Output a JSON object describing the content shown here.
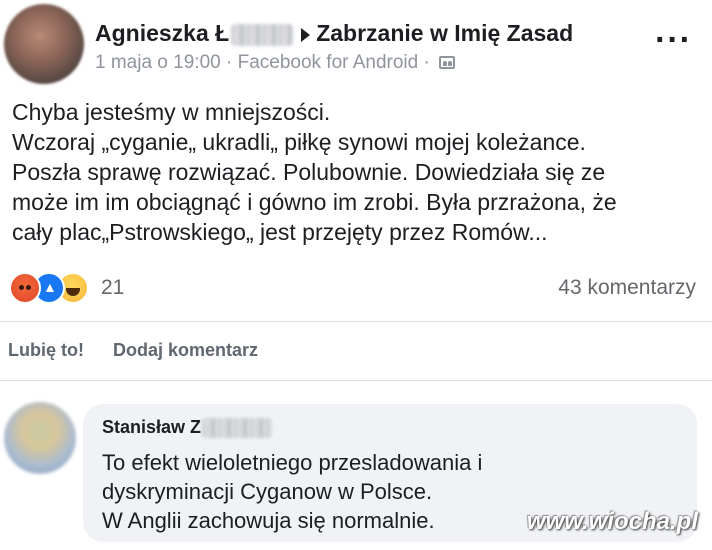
{
  "post": {
    "author_name": "Agnieszka Ł",
    "group_name": "Zabrzanie w Imię Zasad",
    "meta": "1 maja o 19:00 · Facebook for Android ·",
    "text_lines": [
      "Chyba jesteśmy w mniejszości.",
      "Wczoraj „cyganie„ ukradli„ piłkę synowi mojej koleżance.",
      "Poszła sprawę rozwiązać. Polubownie. Dowiedziała się ze",
      "może im im obciągnąć i gówno im zrobi. Była przrażona, że",
      "cały plac„Pstrowskiego„ jest przejęty przez Romów..."
    ],
    "reactions": {
      "icons": [
        "angry-icon",
        "like-icon",
        "haha-icon"
      ],
      "count": "21"
    },
    "comments_count": "43 komentarzy"
  },
  "actions": {
    "like_label": "Lubię to!",
    "comment_label": "Dodaj komentarz"
  },
  "comment": {
    "author_name": "Stanisław Z",
    "text_lines": [
      "To efekt wieloletniego przesladowania i",
      "dyskryminacji Cyganow w Polsce.",
      "W Anglii zachowuja się normalnie."
    ]
  },
  "watermark": "www.wiocha.pl",
  "colors": {
    "text_primary": "#1c1e21",
    "text_secondary": "#65676b",
    "comment_bg": "#f0f2f5",
    "like_blue": "#1877f2"
  }
}
